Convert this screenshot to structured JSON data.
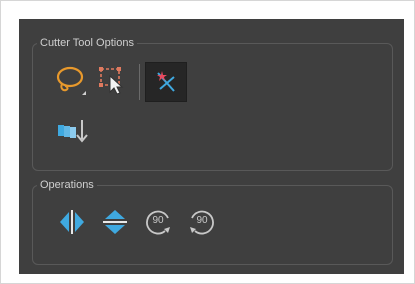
{
  "cutter_tool_options": {
    "title": "Cutter Tool Options",
    "tools": [
      {
        "name": "lasso-tool",
        "icon": "lasso-icon"
      },
      {
        "name": "marquee-select-tool",
        "icon": "marquee-select-icon"
      },
      {
        "name": "use-mouse-gesture-toggle",
        "icon": "mouse-gesture-icon",
        "active": true
      },
      {
        "name": "tip-style-toggle",
        "icon": "tip-style-icon"
      }
    ]
  },
  "operations": {
    "title": "Operations",
    "tools": [
      {
        "name": "flip-horizontal",
        "icon": "flip-horizontal-icon"
      },
      {
        "name": "flip-vertical",
        "icon": "flip-vertical-icon"
      },
      {
        "name": "rotate-90-cw",
        "icon": "rotate-90-cw-icon",
        "label": "90"
      },
      {
        "name": "rotate-90-ccw",
        "icon": "rotate-90-ccw-icon",
        "label": "90"
      }
    ]
  },
  "colors": {
    "panel_bg": "#3f3f3f",
    "accent_orange": "#e8992c",
    "accent_blue": "#3fa9e0",
    "icon_gray": "#c8c8c8"
  }
}
